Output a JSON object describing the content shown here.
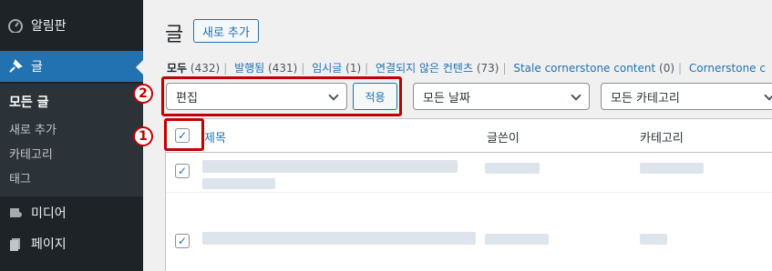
{
  "sidebar": {
    "dashboard_label": "알림판",
    "posts_label": "글",
    "submenu": [
      "모든 글",
      "새로 추가",
      "카테고리",
      "태그"
    ],
    "media_label": "미디어",
    "pages_label": "페이지"
  },
  "header": {
    "title": "글",
    "add_new_label": "새로 추가"
  },
  "views": {
    "all": "모두",
    "all_count": "(432)",
    "published": "발행됨",
    "published_count": "(431)",
    "draft": "임시글",
    "draft_count": "(1)",
    "orphan": "연결되지 않은 컨텐츠",
    "orphan_count": "(73)",
    "stale": "Stale cornerstone content",
    "stale_count": "(0)",
    "cornerstone": "Cornerstone c"
  },
  "filters": {
    "bulk_action_value": "편집",
    "apply_label": "적용",
    "date_value": "모든 날짜",
    "category_value": "모든 카테고리"
  },
  "markers": {
    "one": "1",
    "two": "2"
  },
  "table": {
    "col_title": "제목",
    "col_author": "글쓴이",
    "col_category": "카테고리"
  },
  "colors": {
    "highlight": "#c00000",
    "accent": "#2271b1",
    "sidebar_bg": "#1d2327"
  }
}
